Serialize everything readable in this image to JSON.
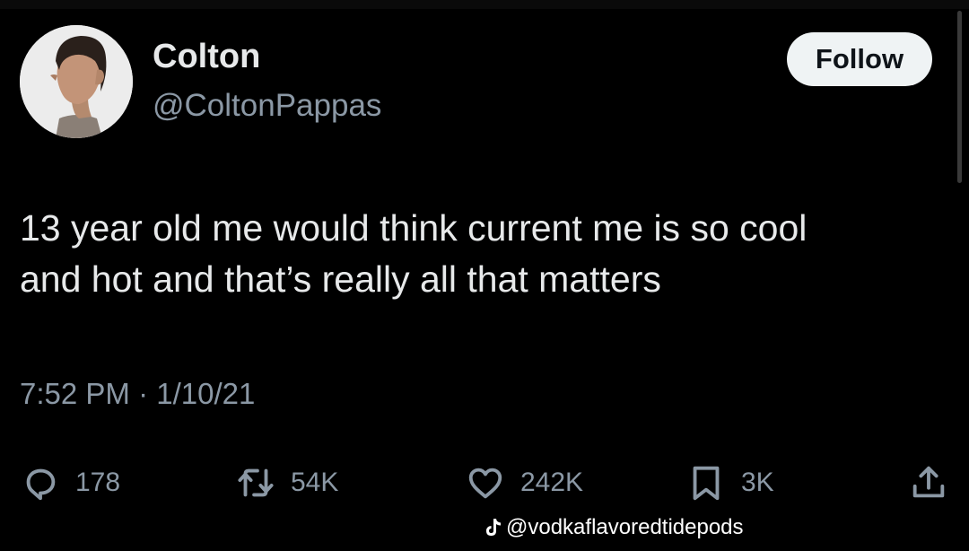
{
  "profile": {
    "name": "Colton",
    "handle": "@ColtonPappas",
    "avatar_icon": "profile-photo"
  },
  "follow_button": {
    "label": "Follow"
  },
  "tweet": {
    "lines": [
      "13 year old me would think current me is so cool",
      "and hot and that’s really all that matters"
    ],
    "time": "7:52 PM",
    "separator": "·",
    "date": "1/10/21"
  },
  "actions": {
    "replies": {
      "icon": "reply-icon",
      "count": "178"
    },
    "retweets": {
      "icon": "retweet-icon",
      "count": "54K"
    },
    "likes": {
      "icon": "heart-icon",
      "count": "242K"
    },
    "bookmarks": {
      "icon": "bookmark-icon",
      "count": "3K"
    },
    "share": {
      "icon": "share-icon"
    }
  },
  "watermark": {
    "icon": "tiktok-icon",
    "text": "@vodkaflavoredtidepods"
  },
  "colors": {
    "background": "#000000",
    "text": "#e7e9ea",
    "secondary": "#8b98a5",
    "button_bg": "#eff3f4"
  }
}
